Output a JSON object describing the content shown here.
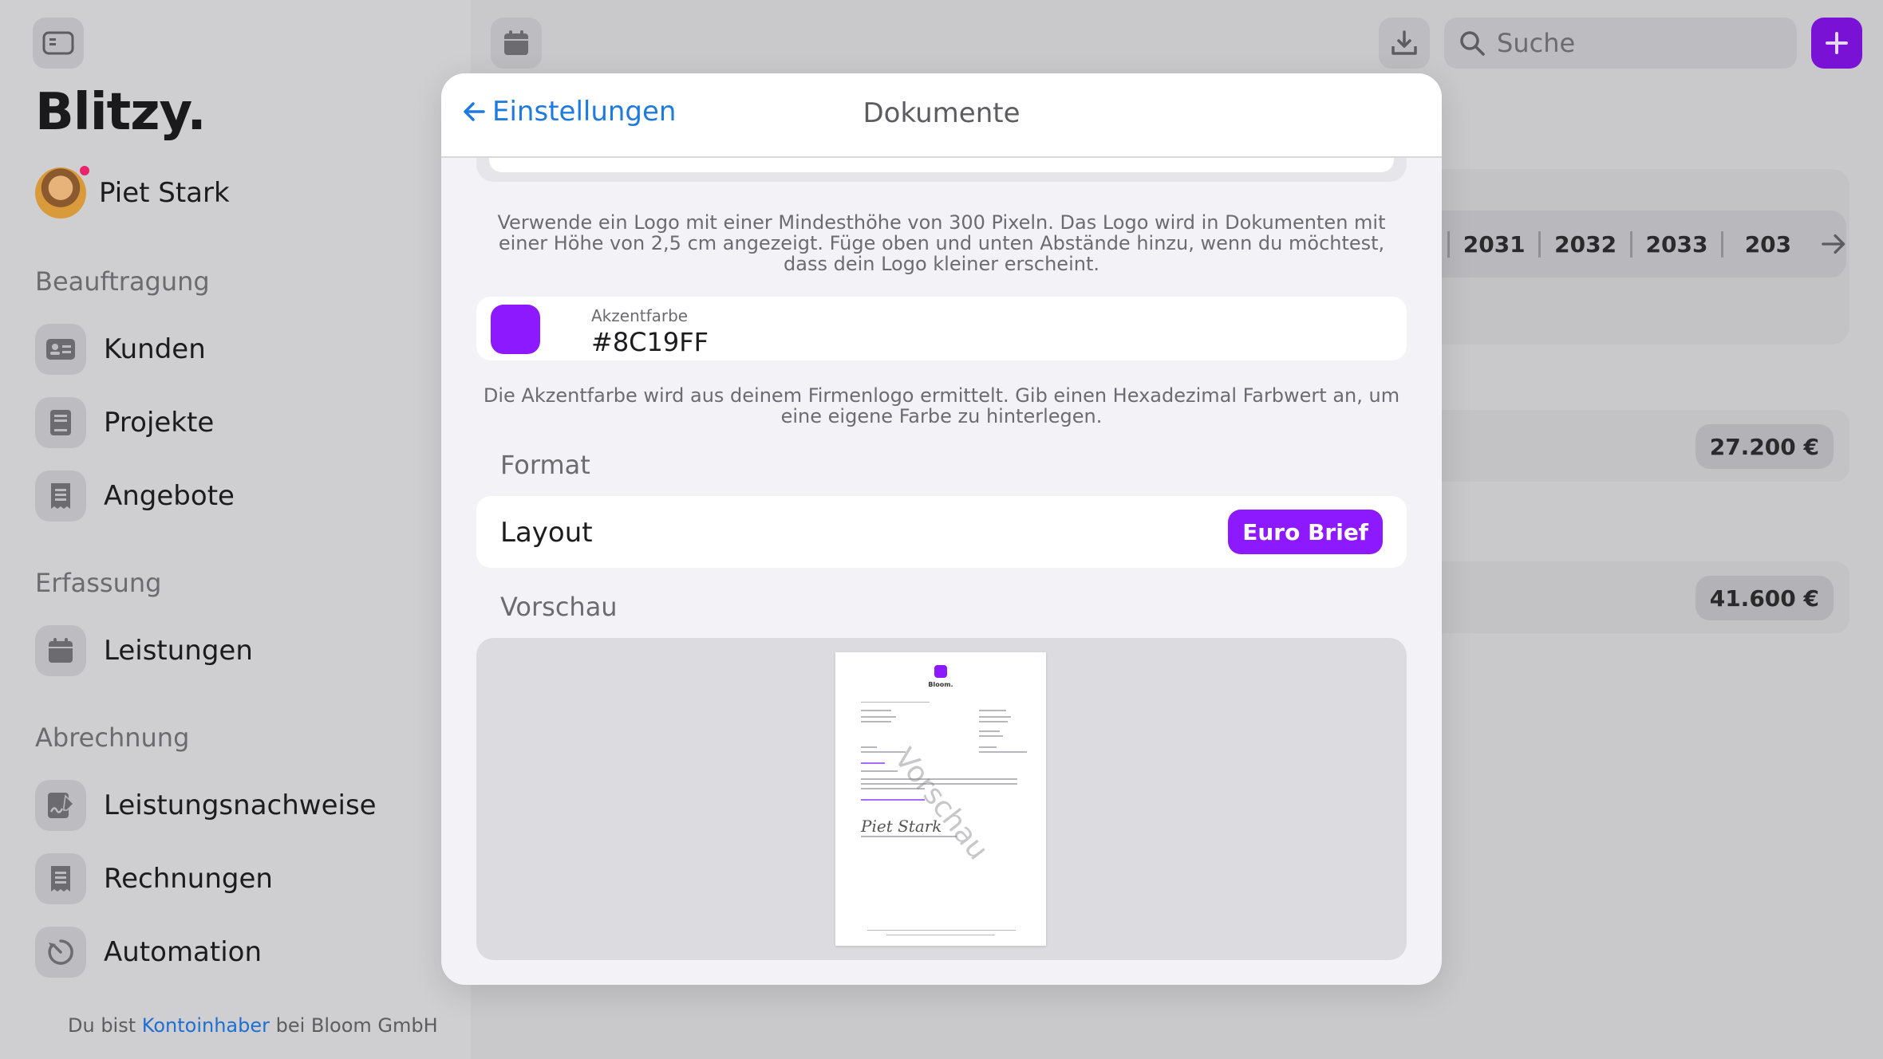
{
  "app": {
    "brand": "Blitzy."
  },
  "user": {
    "name": "Piet Stark",
    "has_notification": true
  },
  "sidebar": {
    "sections": [
      {
        "title": "Beauftragung"
      },
      {
        "title": "Erfassung"
      },
      {
        "title": "Abrechnung"
      }
    ],
    "items": [
      {
        "label": "Kunden",
        "icon": "contact-card-icon"
      },
      {
        "label": "Projekte",
        "icon": "book-icon"
      },
      {
        "label": "Angebote",
        "icon": "receipt-icon"
      },
      {
        "label": "Leistungen",
        "icon": "calendar-icon"
      },
      {
        "label": "Leistungsnachweise",
        "icon": "signed-document-icon"
      },
      {
        "label": "Rechnungen",
        "icon": "invoice-icon"
      },
      {
        "label": "Automation",
        "icon": "timer-icon"
      }
    ],
    "footer": {
      "prefix": "Du bist",
      "link": "Kontoinhaber",
      "suffix": "bei Bloom GmbH"
    }
  },
  "topbar": {
    "search_placeholder": "Suche"
  },
  "background": {
    "years": [
      "2031",
      "2032",
      "2033",
      "203"
    ],
    "amounts": [
      "27.200 €",
      "41.600 €"
    ]
  },
  "modal": {
    "back_label": "Einstellungen",
    "title": "Dokumente",
    "logo_note": "Verwende ein Logo mit einer Mindesthöhe von 300 Pixeln. Das Logo wird in Dokumenten mit einer Höhe von 2,5 cm angezeigt. Füge oben und unten Abstände hinzu, wenn du möchtest, dass dein Logo kleiner erscheint.",
    "accent": {
      "caption": "Akzentfarbe",
      "value": "#8C19FF",
      "color": "#8C19FF"
    },
    "accent_note": "Die Akzentfarbe wird aus deinem Firmenlogo ermittelt. Gib einen Hexadezimal Farbwert an, um eine eigene Farbe zu hinterlegen.",
    "format": {
      "section_title": "Format",
      "layout_label": "Layout",
      "layout_value": "Euro Brief"
    },
    "preview": {
      "section_title": "Vorschau",
      "watermark": "Vorschau",
      "doc_logo_text": "Bloom.",
      "signature": "Piet Stark"
    }
  },
  "colors": {
    "accent": "#8C19FF",
    "link": "#1F7AE0",
    "notification": "#E8246A"
  }
}
